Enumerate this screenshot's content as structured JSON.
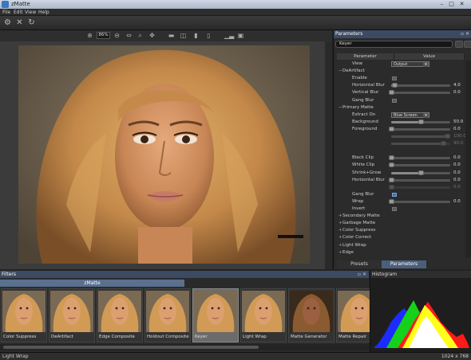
{
  "window": {
    "title": "zMatte"
  },
  "menu": [
    "File",
    "Edit",
    "View",
    "Help"
  ],
  "viewbar": {
    "zoom": "86%"
  },
  "panel": {
    "title": "Parameters",
    "preset": "Keyer",
    "col_param": "Parameter",
    "col_value": "Value",
    "rows": [
      {
        "kind": "combo",
        "label": "View",
        "value": "Output"
      },
      {
        "kind": "section",
        "label": "DeArtifact",
        "expanded": true
      },
      {
        "kind": "check",
        "label": "Enable",
        "checked": false
      },
      {
        "kind": "slider",
        "label": "Horizontal Blur",
        "level": 0.06,
        "value": "4.0"
      },
      {
        "kind": "slider",
        "label": "Vertical Blur",
        "level": 0.0,
        "value": "0.0"
      },
      {
        "kind": "check",
        "label": "Gang Blur",
        "checked": false
      },
      {
        "kind": "section",
        "label": "Primary Matte",
        "expanded": true
      },
      {
        "kind": "combo",
        "label": "Extract On",
        "value": "Blue Screen"
      },
      {
        "kind": "slider",
        "label": "Background",
        "level": 0.5,
        "value": "50.0"
      },
      {
        "kind": "slider",
        "label": "Foreground",
        "level": 0.0,
        "value": "0.0"
      },
      {
        "kind": "dim",
        "label": "",
        "level": 0.95,
        "value": "100.0"
      },
      {
        "kind": "dim",
        "label": "",
        "level": 0.88,
        "value": "90.0"
      },
      {
        "kind": "spacer"
      },
      {
        "kind": "slider",
        "label": "Black Clip",
        "level": 0.0,
        "value": "0.0"
      },
      {
        "kind": "slider",
        "label": "White Clip",
        "level": 0.0,
        "value": "0.0"
      },
      {
        "kind": "slider",
        "label": "Shrink+Grow",
        "level": 0.5,
        "value": "0.0"
      },
      {
        "kind": "slider",
        "label": "Horizontal Blur",
        "level": 0.0,
        "value": "0.0"
      },
      {
        "kind": "dim",
        "label": "",
        "level": 0.0,
        "value": "0.0"
      },
      {
        "kind": "check",
        "label": "Gang Blur",
        "checked": true
      },
      {
        "kind": "slider",
        "label": "Wrap",
        "level": 0.0,
        "value": "0.0"
      },
      {
        "kind": "check",
        "label": "Invert",
        "checked": false
      },
      {
        "kind": "section",
        "label": "Secondary Matte",
        "expanded": false
      },
      {
        "kind": "section",
        "label": "Garbage Matte",
        "expanded": false
      },
      {
        "kind": "section",
        "label": "Color Suppress",
        "expanded": false
      },
      {
        "kind": "section",
        "label": "Color Correct",
        "expanded": false
      },
      {
        "kind": "section",
        "label": "Light Wrap",
        "expanded": false
      },
      {
        "kind": "section",
        "label": "Edge",
        "expanded": false
      }
    ],
    "tabs": [
      "Presets",
      "Parameters"
    ]
  },
  "filters": {
    "title": "Filters",
    "tab": "zMatte",
    "items": [
      "Color Suppress",
      "DeArtifact",
      "Edge Composite",
      "Holdout Composite",
      "Keyer",
      "Light Wrap",
      "Matte Generator",
      "Matte Repair"
    ],
    "selected": 4
  },
  "histogram": {
    "title": "Histogram"
  },
  "status": {
    "left": "Light Wrap",
    "right": "1024 x 768"
  }
}
